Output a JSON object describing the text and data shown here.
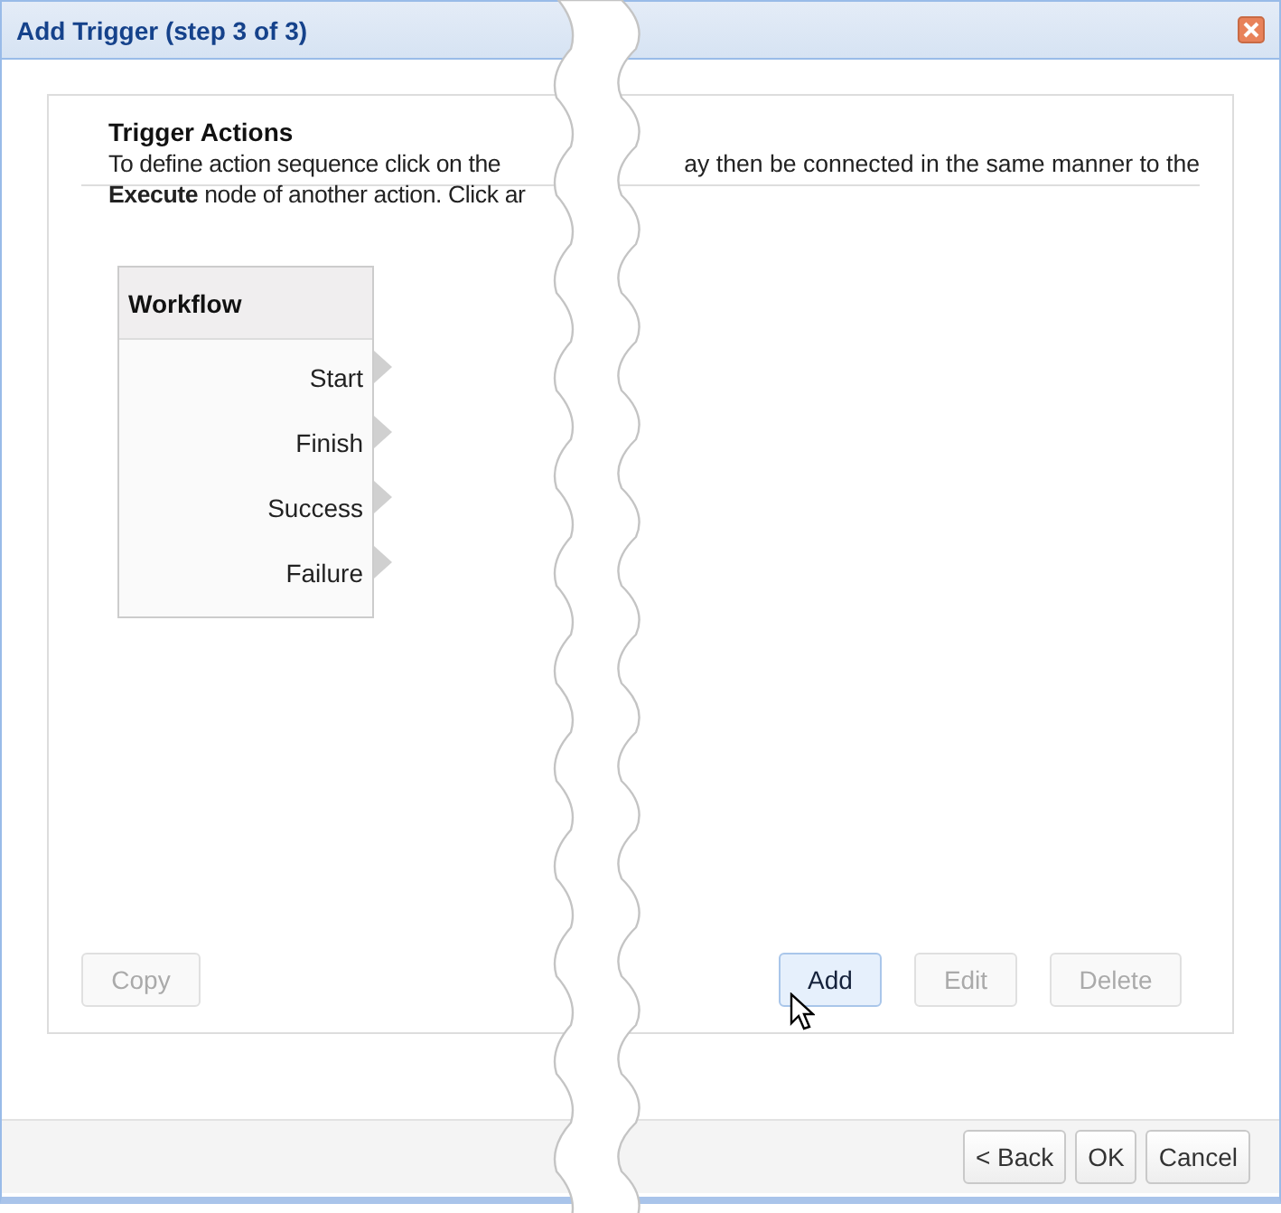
{
  "window": {
    "title": "Add Trigger (step 3 of 3)"
  },
  "panel": {
    "heading": "Trigger Actions",
    "intro_left": [
      "To define action sequence click on the",
      "**Execute** node of another action. Click ar"
    ],
    "intro_right": [
      "ay then be connected in the same manner to the"
    ]
  },
  "node": {
    "title": "Workflow",
    "ports": [
      "Start",
      "Finish",
      "Success",
      "Failure"
    ]
  },
  "action_buttons": [
    {
      "label": "Copy",
      "disabled": true,
      "hovered": false
    },
    {
      "label": "Add",
      "disabled": false,
      "hovered": true
    },
    {
      "label": "Edit",
      "disabled": true,
      "hovered": false
    },
    {
      "label": "Delete",
      "disabled": true,
      "hovered": false
    }
  ],
  "footer_buttons": [
    {
      "label": "< Back"
    },
    {
      "label": "OK"
    },
    {
      "label": "Cancel"
    }
  ]
}
